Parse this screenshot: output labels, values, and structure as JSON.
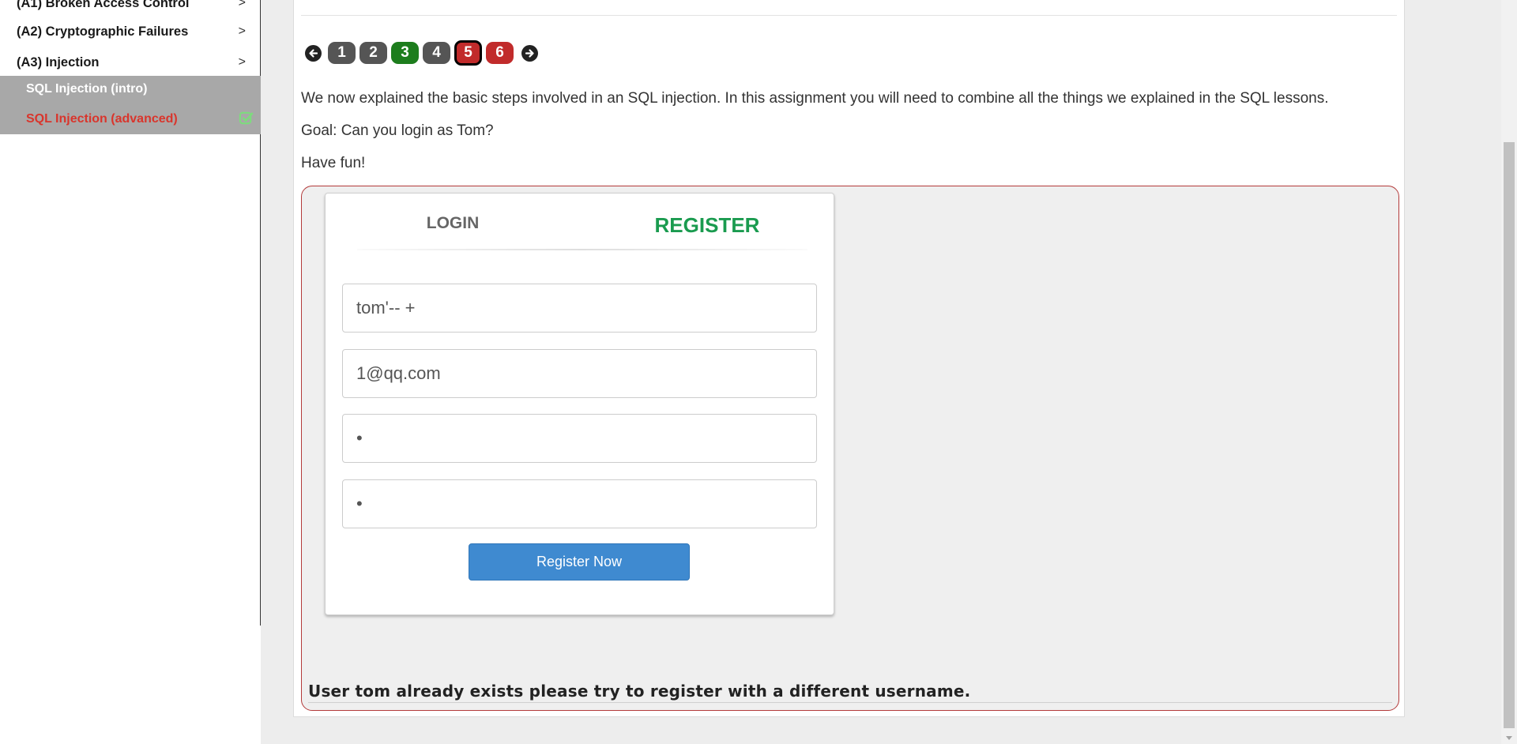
{
  "sidebar": {
    "categories": [
      {
        "label": "(A1) Broken Access Control",
        "chevron": ">"
      },
      {
        "label": "(A2) Cryptographic Failures",
        "chevron": ">"
      },
      {
        "label": "(A3) Injection",
        "chevron": ">"
      }
    ],
    "lessons": [
      {
        "label": "SQL Injection (intro)"
      },
      {
        "label": "SQL Injection (advanced)",
        "completed": true
      }
    ]
  },
  "pager": {
    "pages": [
      "1",
      "2",
      "3",
      "4",
      "5",
      "6"
    ],
    "current": "5",
    "statuses": [
      "default",
      "default",
      "solved",
      "default",
      "failed",
      "failed"
    ]
  },
  "content": {
    "intro": "We now explained the basic steps involved in an SQL injection. In this assignment you will need to combine all the things we explained in the SQL lessons.",
    "goal": "Goal: Can you login as Tom?",
    "have_fun": "Have fun!"
  },
  "form": {
    "tab_login": "LOGIN",
    "tab_register": "REGISTER",
    "username_value": "tom'-- +",
    "email_value": "1@qq.com",
    "password_value": "•",
    "confirm_password_value": "•",
    "register_button": "Register Now"
  },
  "feedback": "User tom already exists please try to register with a different username.",
  "colors": {
    "register_tab": "#1a9b4f",
    "register_button": "#3f8ad0",
    "active_lesson": "#d9352c",
    "solved": "#1d7d1d",
    "failed": "#c12b2b"
  }
}
